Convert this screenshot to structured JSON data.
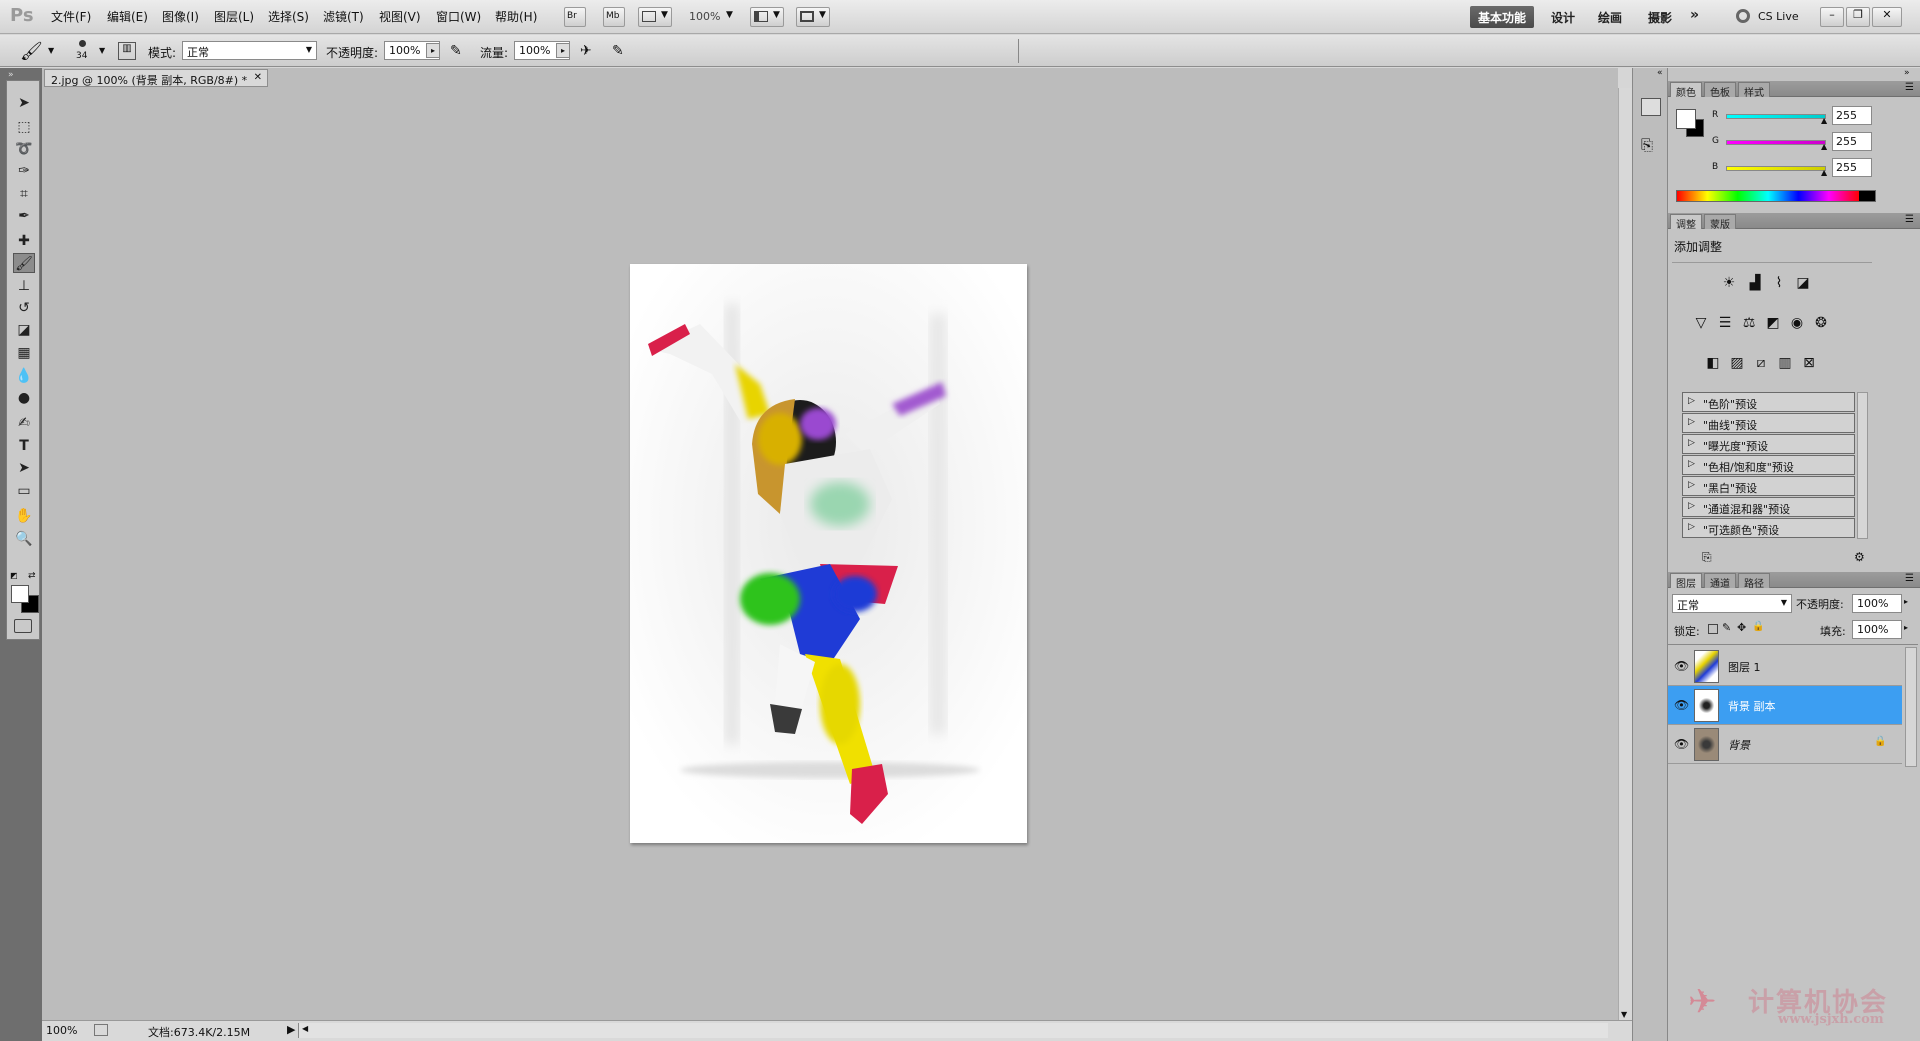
{
  "app": {
    "logo": "Ps"
  },
  "menu": [
    "文件(F)",
    "编辑(E)",
    "图像(I)",
    "图层(L)",
    "选择(S)",
    "滤镜(T)",
    "视图(V)",
    "窗口(W)",
    "帮助(H)"
  ],
  "appbar": {
    "bridge": "Br",
    "minibridge": "Mb",
    "zoom": "100%"
  },
  "workspaces": [
    "基本功能",
    "设计",
    "绘画",
    "摄影"
  ],
  "workspaces_more": "»",
  "cslive": "CS Live",
  "window_controls": {
    "minimize": "–",
    "restore": "❐",
    "close": "✕"
  },
  "options": {
    "brush_size": "34",
    "mode_label": "模式:",
    "mode_value": "正常",
    "opacity_label": "不透明度:",
    "opacity_value": "100%",
    "flow_label": "流量:",
    "flow_value": "100%"
  },
  "document": {
    "tab_title": "2.jpg @ 100% (背景 副本, RGB/8#) *",
    "tab_close": "✕"
  },
  "status": {
    "zoom": "100%",
    "doc_info": "文档:673.4K/2.15M"
  },
  "color_panel": {
    "tabs": [
      "颜色",
      "色板",
      "样式"
    ],
    "channels": [
      {
        "name": "R",
        "value": "255",
        "color": "#00d8d8"
      },
      {
        "name": "G",
        "value": "255",
        "color": "#e000e0"
      },
      {
        "name": "B",
        "value": "255",
        "color": "#e0e000"
      }
    ]
  },
  "adjust_panel": {
    "tabs": [
      "调整",
      "蒙版"
    ],
    "title": "添加调整",
    "presets": [
      "\"色阶\"预设",
      "\"曲线\"预设",
      "\"曝光度\"预设",
      "\"色相/饱和度\"预设",
      "\"黑白\"预设",
      "\"通道混和器\"预设",
      "\"可选颜色\"预设"
    ]
  },
  "layers_panel": {
    "tabs": [
      "图层",
      "通道",
      "路径"
    ],
    "blend_mode": "正常",
    "opacity_label": "不透明度:",
    "opacity_value": "100%",
    "lock_label": "锁定:",
    "fill_label": "填充:",
    "fill_value": "100%",
    "layers": [
      {
        "name": "图层 1",
        "selected": false
      },
      {
        "name": "背景 副本",
        "selected": true
      },
      {
        "name": "背景",
        "selected": false,
        "locked": true
      }
    ]
  },
  "watermark": {
    "title": "计算机协会",
    "url": "www.jsjxh.com"
  }
}
